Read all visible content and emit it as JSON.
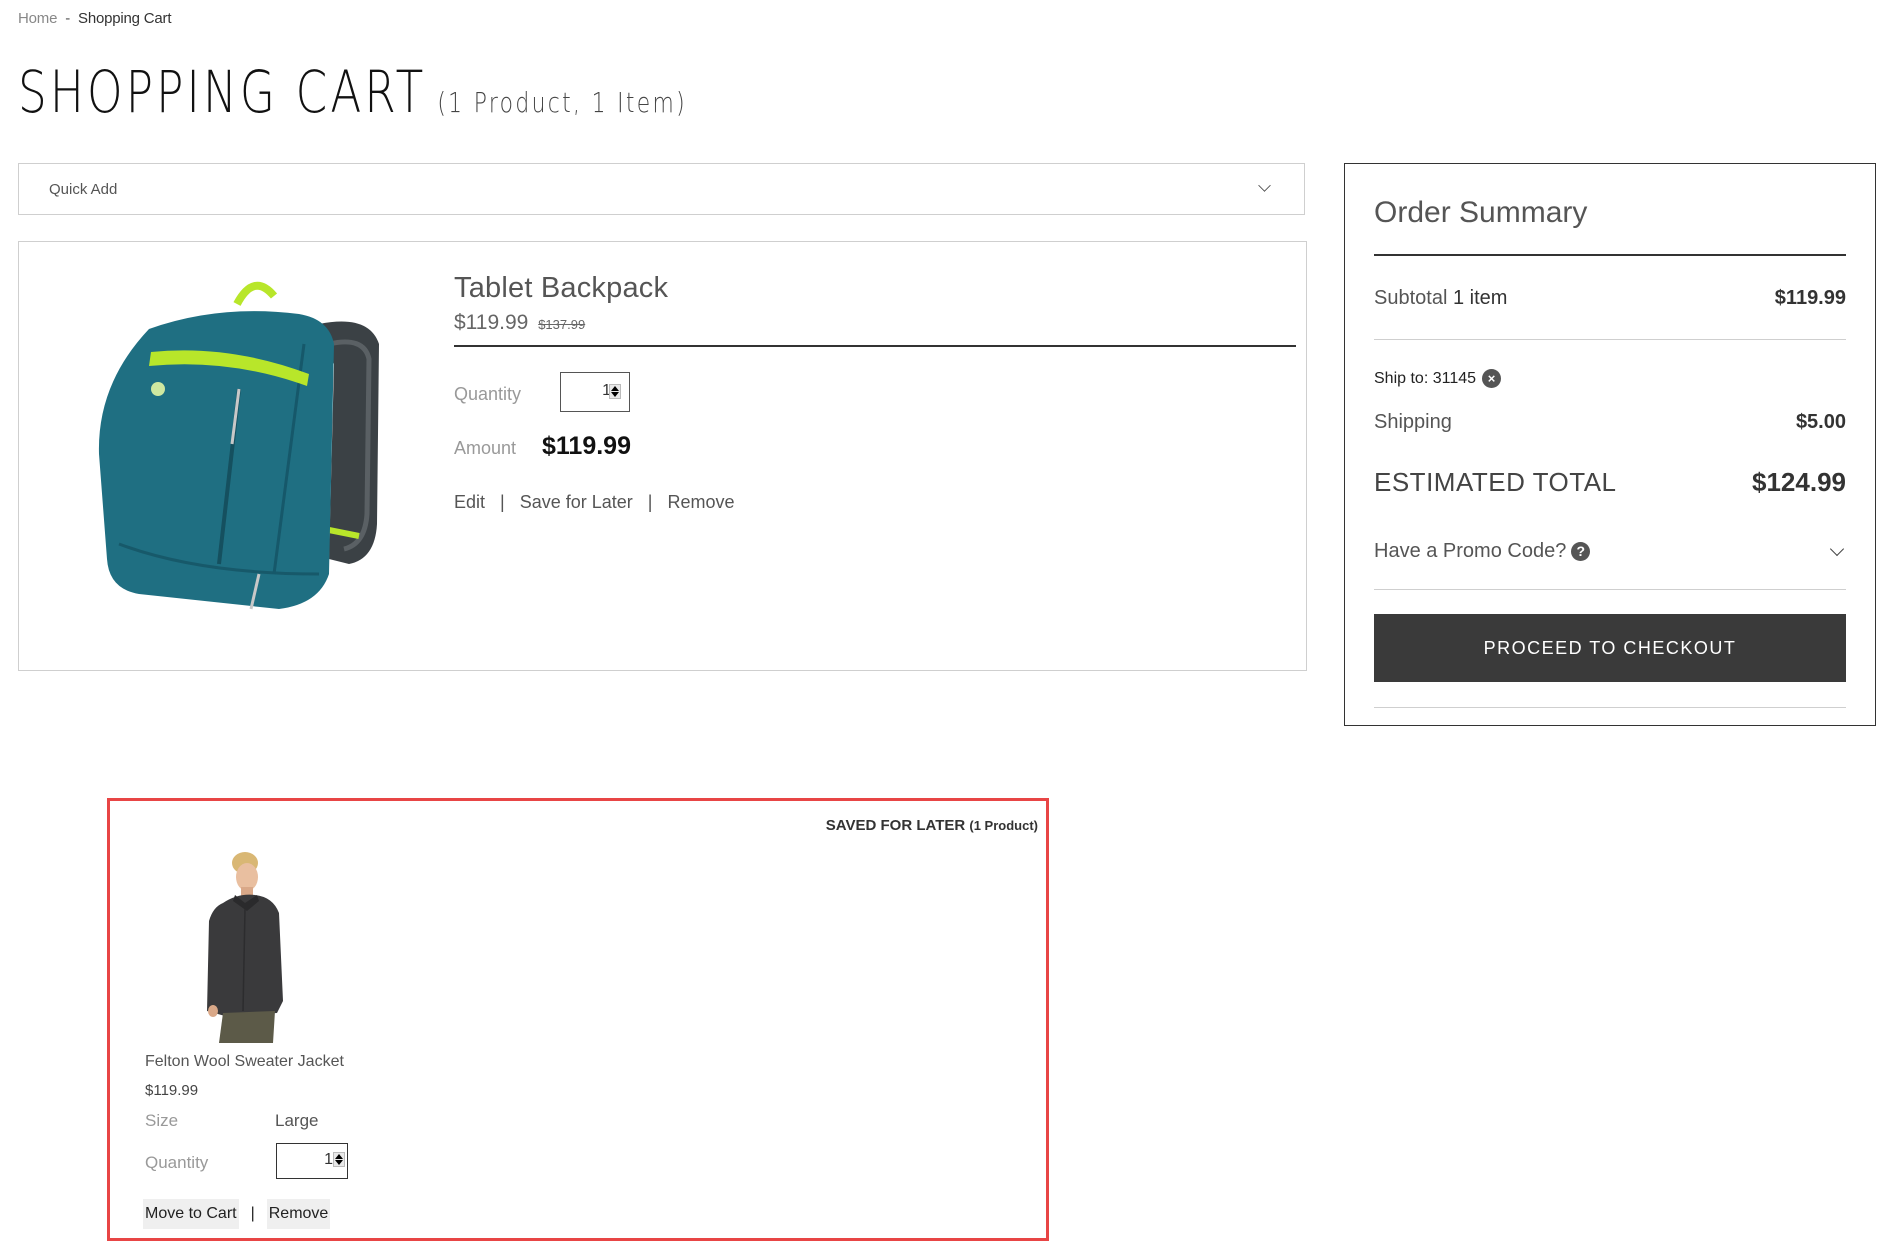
{
  "breadcrumb": {
    "home": "Home",
    "separator": "-",
    "current": "Shopping Cart"
  },
  "page": {
    "title": "SHOPPING CART",
    "count": "(1 Product, 1 Item)"
  },
  "quick_add": {
    "label": "Quick Add",
    "icon": "chevron-down-icon"
  },
  "cart": {
    "items": [
      {
        "name": "Tablet Backpack",
        "price": "$119.99",
        "original_price": "$137.99",
        "quantity_label": "Quantity",
        "quantity": "1",
        "amount_label": "Amount",
        "amount": "$119.99",
        "actions": [
          "Edit",
          "Save for Later",
          "Remove"
        ],
        "action_separator": "|",
        "image": "teal-backpack"
      }
    ]
  },
  "summary": {
    "title": "Order Summary",
    "subtotal_label": "Subtotal",
    "subtotal_items": "1 item",
    "subtotal_value": "$119.99",
    "ship_to_label": "Ship to: 31145",
    "ship_to_clear_icon": "x-circle-icon",
    "shipping_label": "Shipping",
    "shipping_value": "$5.00",
    "estimated_total_label": "ESTIMATED TOTAL",
    "estimated_total_value": "$124.99",
    "promo_label": "Have a Promo Code?",
    "promo_help_icon": "question-circle-icon",
    "promo_chevron_icon": "chevron-down-icon",
    "checkout_label": "PROCEED TO CHECKOUT"
  },
  "saved_for_later": {
    "heading": "SAVED FOR LATER",
    "heading_count": "(1 Product)",
    "items": [
      {
        "name": "Felton Wool Sweater Jacket",
        "price": "$119.99",
        "size_label": "Size",
        "size": "Large",
        "quantity_label": "Quantity",
        "quantity": "1",
        "move_label": "Move to Cart",
        "separator": "|",
        "remove_label": "Remove",
        "image": "man-in-dark-sweater-jacket"
      }
    ]
  },
  "colors": {
    "checkout_bg": "#3a3a3a",
    "saved_border": "#e84545",
    "backpack_teal": "#1f6f82",
    "backpack_accent": "#b8e62a"
  }
}
